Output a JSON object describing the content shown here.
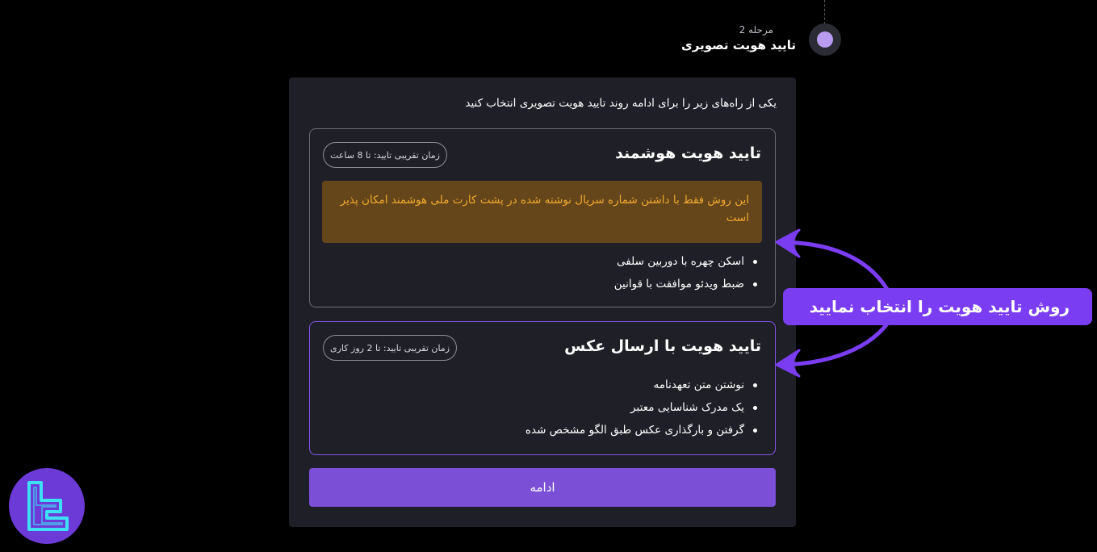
{
  "step": {
    "label": "مرحله 2",
    "title": "تایید هویت تصویری"
  },
  "panel": {
    "intro": "یکی از راه‌های زیر را برای ادامه روند تایید هویت تصویری انتخاب کنید",
    "options": [
      {
        "title": "تایید هویت هوشمند",
        "time_badge": "زمان تقریبی تایید: تا 8 ساعت",
        "warning": "این روش فقط با داشتن شماره سریال نوشته شده در پشت کارت ملی هوشمند امکان پذیر است",
        "requirements": [
          "اسکن چهره با دوربین سلفی",
          "ضبط ویدئو موافقت با قوانین"
        ]
      },
      {
        "title": "تایید هویت با ارسال عکس",
        "time_badge": "زمان تقریبی تایید: تا 2 روز کاری",
        "requirements": [
          "نوشتن متن تعهدنامه",
          "یک مدرک شناسایی معتبر",
          "گرفتن و بارگذاری عکس طبق الگو مشخص شده"
        ]
      }
    ],
    "continue_label": "ادامه"
  },
  "annotation": {
    "callout": "روش تایید هویت را انتخاب نمایید"
  },
  "colors": {
    "accent": "#7b4fd6",
    "warning_text": "#f0a82e",
    "warning_bg": "#65461a",
    "callout_bg": "#7a3df2",
    "panel_bg": "#1f2027",
    "selected_border": "#8454e8"
  },
  "icons": {
    "logo": "brand-logo-icon",
    "step": "step-indicator-icon",
    "arrows": "annotation-arrow-icon"
  }
}
